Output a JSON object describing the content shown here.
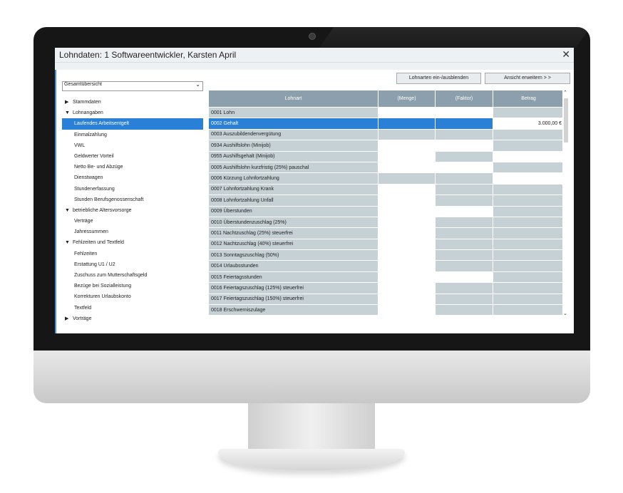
{
  "window": {
    "title": "Lohndaten: 1  Softwareentwickler, Karsten   April",
    "close_label": "✕"
  },
  "overview_select": {
    "value": "Gesamtübersicht"
  },
  "tree": [
    {
      "label": "Stammdaten",
      "level": 0,
      "arrow": "right"
    },
    {
      "label": "Lohnangaben",
      "level": 0,
      "arrow": "down"
    },
    {
      "label": "Laufendes Arbeitsentgelt",
      "level": 1,
      "selected": true
    },
    {
      "label": "Einmalzahlung",
      "level": 1
    },
    {
      "label": "VWL",
      "level": 1
    },
    {
      "label": "Geldwerter Vorteil",
      "level": 1
    },
    {
      "label": "Netto Be- und Abzüge",
      "level": 1
    },
    {
      "label": "Dienstwagen",
      "level": 1
    },
    {
      "label": "Stundenerfassung",
      "level": 1
    },
    {
      "label": "Stunden Berufsgenossenschaft",
      "level": 1
    },
    {
      "label": "betriebliche Altersvorsorge",
      "level": 0,
      "arrow": "down"
    },
    {
      "label": "Verträge",
      "level": 1
    },
    {
      "label": "Jahressummen",
      "level": 1
    },
    {
      "label": "Fehlzeiten und Textfeld",
      "level": 0,
      "arrow": "down"
    },
    {
      "label": "Fehlzeiten",
      "level": 1
    },
    {
      "label": "Erstattung U1 / U2",
      "level": 1
    },
    {
      "label": "Zuschuss zum Mutterschaftsgeld",
      "level": 1
    },
    {
      "label": "Bezüge bei Sozialleistung",
      "level": 1
    },
    {
      "label": "Korrekturen Urlaubskonto",
      "level": 1
    },
    {
      "label": "Textfeld",
      "level": 1
    },
    {
      "label": "Vorträge",
      "level": 0,
      "arrow": "right"
    }
  ],
  "toolbar": {
    "toggle_label": "Lohnarten ein-/ausblenden",
    "expand_label": "Ansicht erweitern > >"
  },
  "grid": {
    "columns": [
      "Lohnart",
      "(Menge)",
      "(Faktor)",
      "Betrag"
    ],
    "rows": [
      {
        "name": "0001 Lohn",
        "menge": "",
        "faktor": "",
        "betrag": "",
        "pattern": "wwg"
      },
      {
        "name": "0002 Gehalt",
        "menge": "",
        "faktor": "",
        "betrag": "3.000,00 €",
        "pattern": "ssw",
        "selected": true
      },
      {
        "name": "0003 Auszubildendenvergütung",
        "menge": "",
        "faktor": "",
        "betrag": "",
        "pattern": "ggg"
      },
      {
        "name": "0934 Aushilfslohn (Minijob)",
        "menge": "",
        "faktor": "",
        "betrag": "",
        "pattern": "wwg"
      },
      {
        "name": "0955 Aushilfsgehalt (Minijob)",
        "menge": "",
        "faktor": "",
        "betrag": "",
        "pattern": "wgw"
      },
      {
        "name": "0005 Aushilfslohn kurzfristig (25%) pauschal",
        "menge": "",
        "faktor": "",
        "betrag": "",
        "pattern": "wwg"
      },
      {
        "name": "0006 Kürzung Lohnfortzahlung",
        "menge": "",
        "faktor": "",
        "betrag": "",
        "pattern": "ggw"
      },
      {
        "name": "0007 Lohnfortzahlung Krank",
        "menge": "",
        "faktor": "",
        "betrag": "",
        "pattern": "wgg"
      },
      {
        "name": "0008 Lohnfortzahlung Unfall",
        "menge": "",
        "faktor": "",
        "betrag": "",
        "pattern": "wgg"
      },
      {
        "name": "0009 Überstunden",
        "menge": "",
        "faktor": "",
        "betrag": "",
        "pattern": "wwg"
      },
      {
        "name": "0010 Überstundenzuschlag (25%)",
        "menge": "",
        "faktor": "",
        "betrag": "",
        "pattern": "wgg"
      },
      {
        "name": "0011 Nachtzuschlag (25%) steuerfrei",
        "menge": "",
        "faktor": "",
        "betrag": "",
        "pattern": "wgg"
      },
      {
        "name": "0012 Nachtzuschlag (40%) steuerfrei",
        "menge": "",
        "faktor": "",
        "betrag": "",
        "pattern": "wgg"
      },
      {
        "name": "0013 Sonntagszuschlag (50%)",
        "menge": "",
        "faktor": "",
        "betrag": "",
        "pattern": "wgg"
      },
      {
        "name": "0014 Urlaubsstunden",
        "menge": "",
        "faktor": "",
        "betrag": "",
        "pattern": "wgg"
      },
      {
        "name": "0015 Feiertagsstunden",
        "menge": "",
        "faktor": "",
        "betrag": "",
        "pattern": "wwg"
      },
      {
        "name": "0016 Feiertagszuschlag (125%) steuerfrei",
        "menge": "",
        "faktor": "",
        "betrag": "",
        "pattern": "wgg"
      },
      {
        "name": "0017 Feiertagszuschlag (150%) steuerfrei",
        "menge": "",
        "faktor": "",
        "betrag": "",
        "pattern": "wgg"
      },
      {
        "name": "0018 Erschwerniszulage",
        "menge": "",
        "faktor": "",
        "betrag": "",
        "pattern": "wgg"
      }
    ]
  },
  "colors": {
    "accent": "#2a7fd7",
    "header": "#8c9fad",
    "cell_gray": "#c6d1d6"
  }
}
